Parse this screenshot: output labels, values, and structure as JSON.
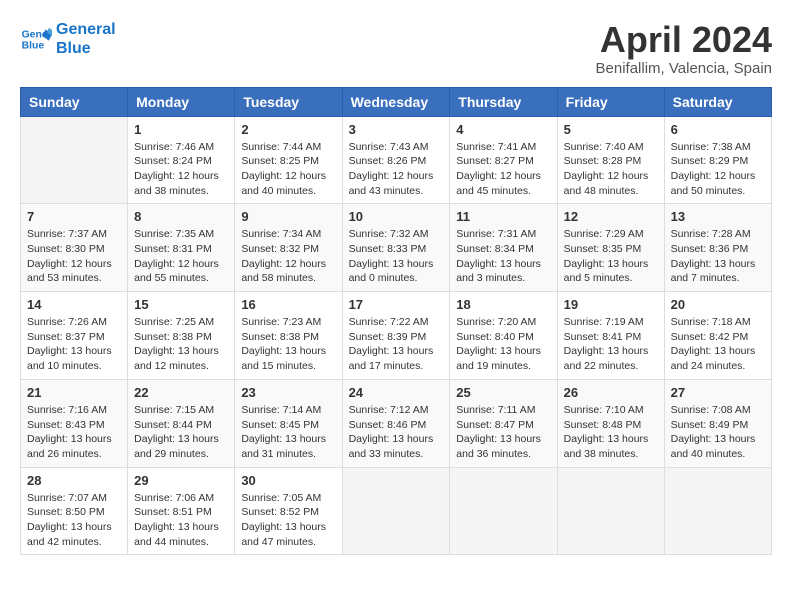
{
  "logo": {
    "line1": "General",
    "line2": "Blue"
  },
  "title": "April 2024",
  "subtitle": "Benifallim, Valencia, Spain",
  "headers": [
    "Sunday",
    "Monday",
    "Tuesday",
    "Wednesday",
    "Thursday",
    "Friday",
    "Saturday"
  ],
  "weeks": [
    [
      {
        "day": "",
        "sunrise": "",
        "sunset": "",
        "daylight": ""
      },
      {
        "day": "1",
        "sunrise": "Sunrise: 7:46 AM",
        "sunset": "Sunset: 8:24 PM",
        "daylight": "Daylight: 12 hours and 38 minutes."
      },
      {
        "day": "2",
        "sunrise": "Sunrise: 7:44 AM",
        "sunset": "Sunset: 8:25 PM",
        "daylight": "Daylight: 12 hours and 40 minutes."
      },
      {
        "day": "3",
        "sunrise": "Sunrise: 7:43 AM",
        "sunset": "Sunset: 8:26 PM",
        "daylight": "Daylight: 12 hours and 43 minutes."
      },
      {
        "day": "4",
        "sunrise": "Sunrise: 7:41 AM",
        "sunset": "Sunset: 8:27 PM",
        "daylight": "Daylight: 12 hours and 45 minutes."
      },
      {
        "day": "5",
        "sunrise": "Sunrise: 7:40 AM",
        "sunset": "Sunset: 8:28 PM",
        "daylight": "Daylight: 12 hours and 48 minutes."
      },
      {
        "day": "6",
        "sunrise": "Sunrise: 7:38 AM",
        "sunset": "Sunset: 8:29 PM",
        "daylight": "Daylight: 12 hours and 50 minutes."
      }
    ],
    [
      {
        "day": "7",
        "sunrise": "Sunrise: 7:37 AM",
        "sunset": "Sunset: 8:30 PM",
        "daylight": "Daylight: 12 hours and 53 minutes."
      },
      {
        "day": "8",
        "sunrise": "Sunrise: 7:35 AM",
        "sunset": "Sunset: 8:31 PM",
        "daylight": "Daylight: 12 hours and 55 minutes."
      },
      {
        "day": "9",
        "sunrise": "Sunrise: 7:34 AM",
        "sunset": "Sunset: 8:32 PM",
        "daylight": "Daylight: 12 hours and 58 minutes."
      },
      {
        "day": "10",
        "sunrise": "Sunrise: 7:32 AM",
        "sunset": "Sunset: 8:33 PM",
        "daylight": "Daylight: 13 hours and 0 minutes."
      },
      {
        "day": "11",
        "sunrise": "Sunrise: 7:31 AM",
        "sunset": "Sunset: 8:34 PM",
        "daylight": "Daylight: 13 hours and 3 minutes."
      },
      {
        "day": "12",
        "sunrise": "Sunrise: 7:29 AM",
        "sunset": "Sunset: 8:35 PM",
        "daylight": "Daylight: 13 hours and 5 minutes."
      },
      {
        "day": "13",
        "sunrise": "Sunrise: 7:28 AM",
        "sunset": "Sunset: 8:36 PM",
        "daylight": "Daylight: 13 hours and 7 minutes."
      }
    ],
    [
      {
        "day": "14",
        "sunrise": "Sunrise: 7:26 AM",
        "sunset": "Sunset: 8:37 PM",
        "daylight": "Daylight: 13 hours and 10 minutes."
      },
      {
        "day": "15",
        "sunrise": "Sunrise: 7:25 AM",
        "sunset": "Sunset: 8:38 PM",
        "daylight": "Daylight: 13 hours and 12 minutes."
      },
      {
        "day": "16",
        "sunrise": "Sunrise: 7:23 AM",
        "sunset": "Sunset: 8:38 PM",
        "daylight": "Daylight: 13 hours and 15 minutes."
      },
      {
        "day": "17",
        "sunrise": "Sunrise: 7:22 AM",
        "sunset": "Sunset: 8:39 PM",
        "daylight": "Daylight: 13 hours and 17 minutes."
      },
      {
        "day": "18",
        "sunrise": "Sunrise: 7:20 AM",
        "sunset": "Sunset: 8:40 PM",
        "daylight": "Daylight: 13 hours and 19 minutes."
      },
      {
        "day": "19",
        "sunrise": "Sunrise: 7:19 AM",
        "sunset": "Sunset: 8:41 PM",
        "daylight": "Daylight: 13 hours and 22 minutes."
      },
      {
        "day": "20",
        "sunrise": "Sunrise: 7:18 AM",
        "sunset": "Sunset: 8:42 PM",
        "daylight": "Daylight: 13 hours and 24 minutes."
      }
    ],
    [
      {
        "day": "21",
        "sunrise": "Sunrise: 7:16 AM",
        "sunset": "Sunset: 8:43 PM",
        "daylight": "Daylight: 13 hours and 26 minutes."
      },
      {
        "day": "22",
        "sunrise": "Sunrise: 7:15 AM",
        "sunset": "Sunset: 8:44 PM",
        "daylight": "Daylight: 13 hours and 29 minutes."
      },
      {
        "day": "23",
        "sunrise": "Sunrise: 7:14 AM",
        "sunset": "Sunset: 8:45 PM",
        "daylight": "Daylight: 13 hours and 31 minutes."
      },
      {
        "day": "24",
        "sunrise": "Sunrise: 7:12 AM",
        "sunset": "Sunset: 8:46 PM",
        "daylight": "Daylight: 13 hours and 33 minutes."
      },
      {
        "day": "25",
        "sunrise": "Sunrise: 7:11 AM",
        "sunset": "Sunset: 8:47 PM",
        "daylight": "Daylight: 13 hours and 36 minutes."
      },
      {
        "day": "26",
        "sunrise": "Sunrise: 7:10 AM",
        "sunset": "Sunset: 8:48 PM",
        "daylight": "Daylight: 13 hours and 38 minutes."
      },
      {
        "day": "27",
        "sunrise": "Sunrise: 7:08 AM",
        "sunset": "Sunset: 8:49 PM",
        "daylight": "Daylight: 13 hours and 40 minutes."
      }
    ],
    [
      {
        "day": "28",
        "sunrise": "Sunrise: 7:07 AM",
        "sunset": "Sunset: 8:50 PM",
        "daylight": "Daylight: 13 hours and 42 minutes."
      },
      {
        "day": "29",
        "sunrise": "Sunrise: 7:06 AM",
        "sunset": "Sunset: 8:51 PM",
        "daylight": "Daylight: 13 hours and 44 minutes."
      },
      {
        "day": "30",
        "sunrise": "Sunrise: 7:05 AM",
        "sunset": "Sunset: 8:52 PM",
        "daylight": "Daylight: 13 hours and 47 minutes."
      },
      {
        "day": "",
        "sunrise": "",
        "sunset": "",
        "daylight": ""
      },
      {
        "day": "",
        "sunrise": "",
        "sunset": "",
        "daylight": ""
      },
      {
        "day": "",
        "sunrise": "",
        "sunset": "",
        "daylight": ""
      },
      {
        "day": "",
        "sunrise": "",
        "sunset": "",
        "daylight": ""
      }
    ]
  ]
}
